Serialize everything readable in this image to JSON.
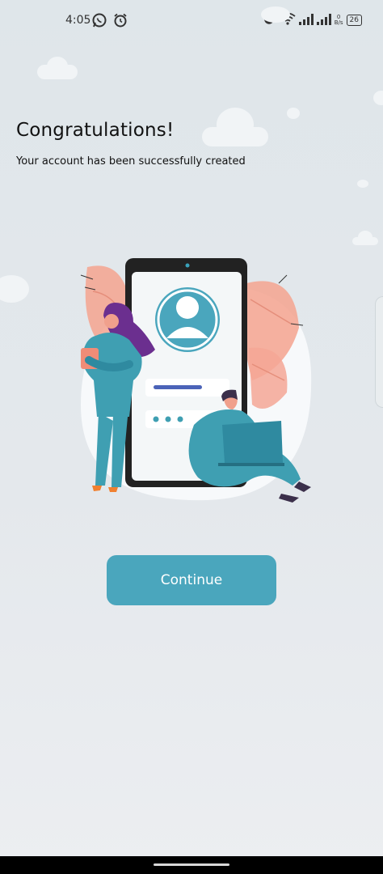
{
  "status_bar": {
    "time": "4:05",
    "network_speed_top": "0",
    "network_speed_unit": "B/s",
    "battery": "26",
    "icons": [
      "whatsapp-icon",
      "alarm-icon",
      "alarm-icon",
      "wifi-icon",
      "signal-icon",
      "signal-icon",
      "battery-icon"
    ]
  },
  "screen": {
    "title": "Congratulations!",
    "subtitle": "Your account has been successfully created",
    "illustration": "account-created-illustration"
  },
  "actions": {
    "continue_label": "Continue"
  },
  "colors": {
    "accent": "#4aa6bd",
    "background": "#e3e8eb",
    "leaf": "#f4a795",
    "figure": "#3f9fb2",
    "hair": "#6b2f8f",
    "phone_frame": "#222222"
  }
}
